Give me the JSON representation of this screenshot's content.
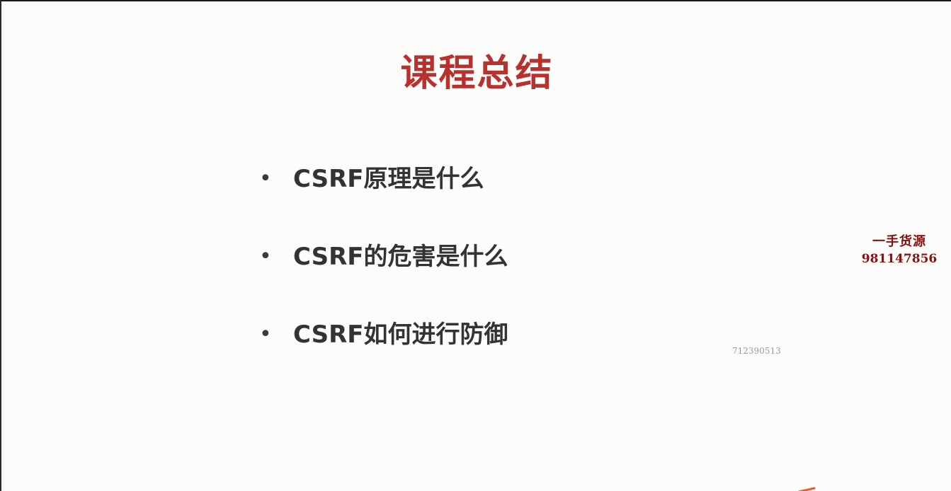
{
  "slide": {
    "title": "课程总结",
    "bullets": [
      {
        "marker": "•",
        "text": "CSRF原理是什么"
      },
      {
        "marker": "•",
        "text": "CSRF的危害是什么"
      },
      {
        "marker": "•",
        "text": "CSRF如何进行防御"
      }
    ]
  },
  "overlay": {
    "watermark_line1": "一手货源",
    "watermark_line2": "981147856",
    "small_id": "712390513"
  },
  "colors": {
    "title": "#b8312f",
    "bullet_text": "#333333",
    "watermark": "#8b1010",
    "annotation_stroke": "#f05a28"
  }
}
